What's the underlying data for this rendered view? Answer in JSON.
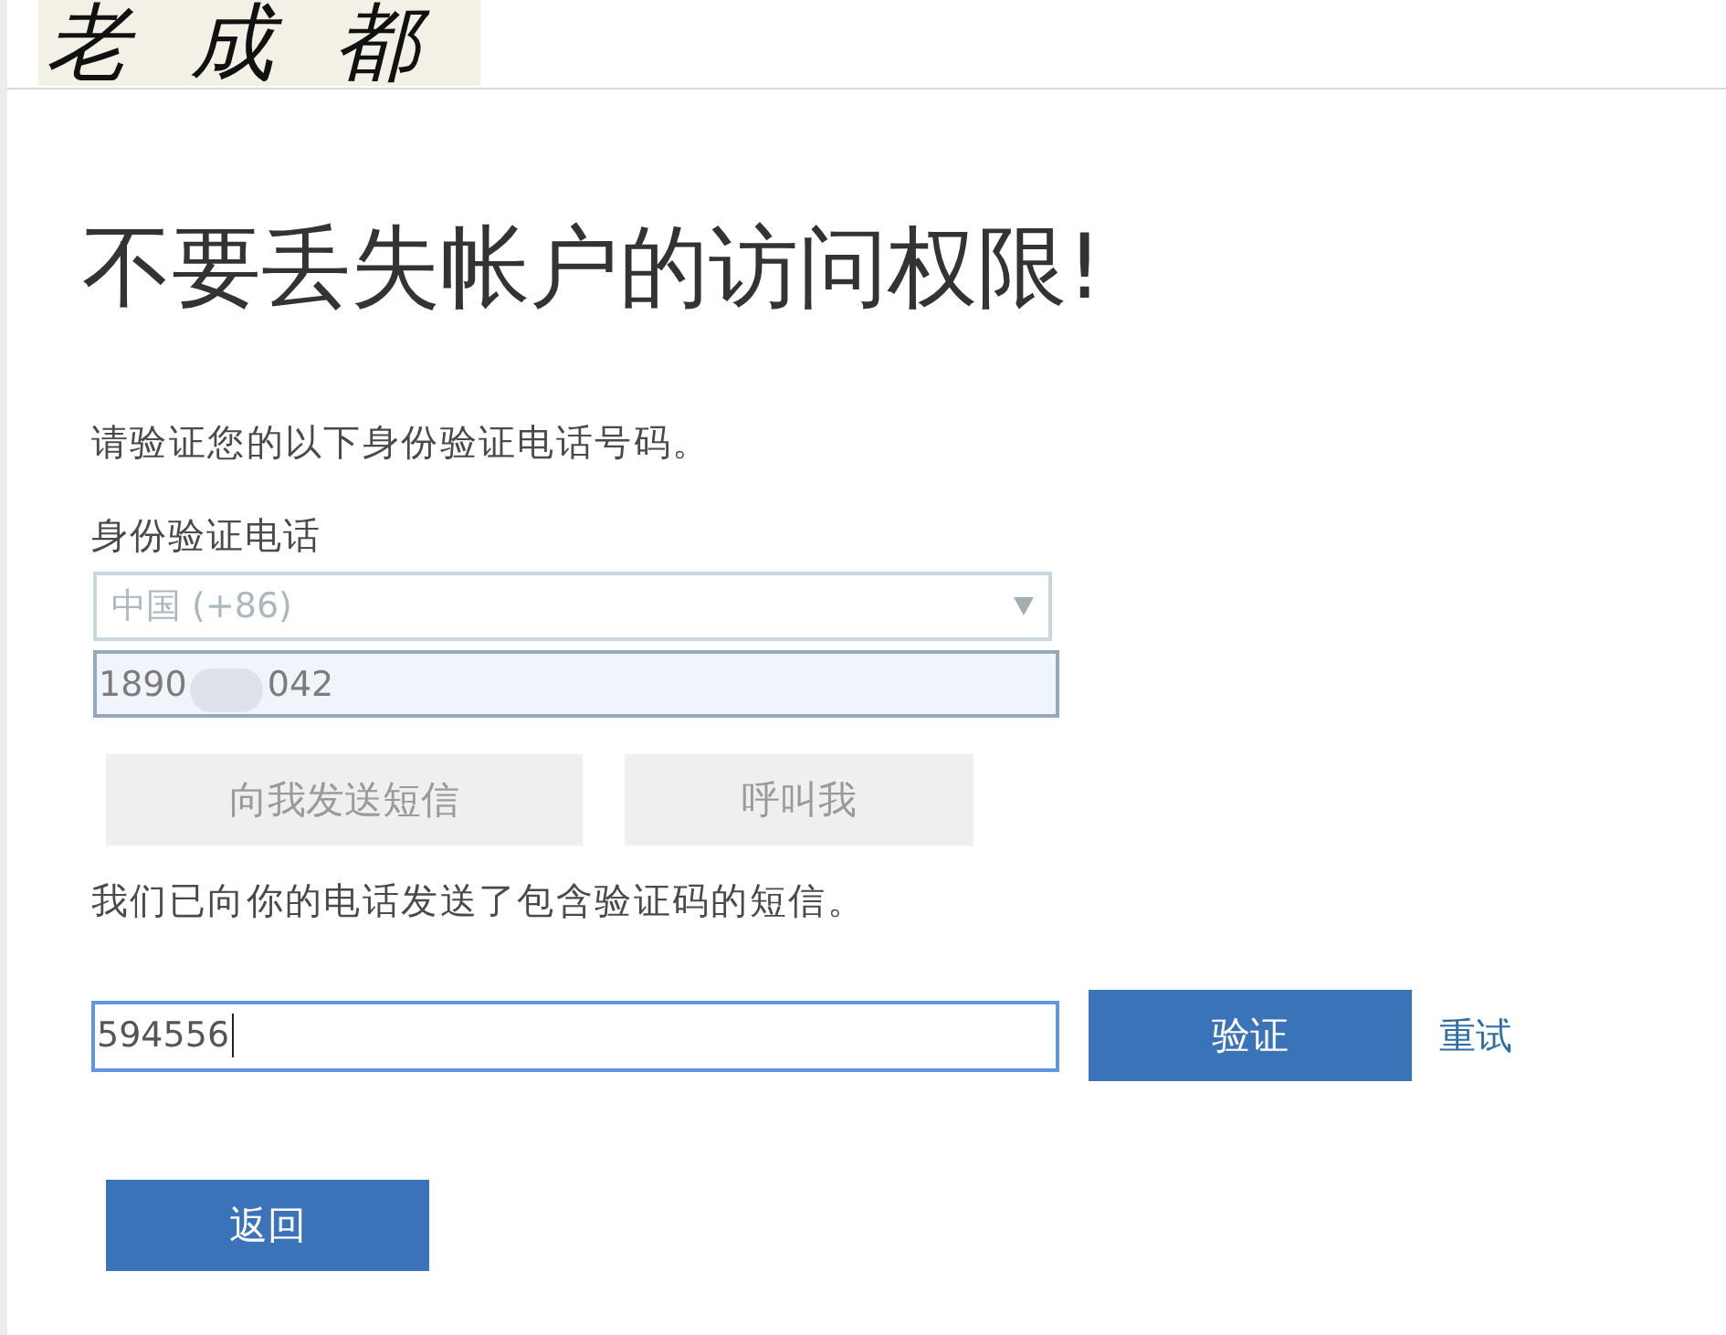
{
  "header": {
    "logo": "老成都"
  },
  "title": "不要丢失帐户的访问权限!",
  "instruction": "请验证您的以下身份验证电话号码。",
  "phone_section": {
    "label": "身份验证电话",
    "country_select": {
      "value": "中国 (+86)",
      "disabled": true
    },
    "phone_field": {
      "value_start": "1890",
      "value_end": "042",
      "redacted": true
    },
    "buttons": [
      {
        "label": "向我发送短信",
        "disabled": true
      },
      {
        "label": "呼叫我",
        "disabled": true
      }
    ]
  },
  "sent_message": "我们已向你的电话发送了包含验证码的短信。",
  "code_form": {
    "code_field": {
      "value": "594556",
      "focused": true
    },
    "verify_button": {
      "label": "验证"
    },
    "retry_link": "重试"
  },
  "back_button": {
    "label": "返回"
  }
}
